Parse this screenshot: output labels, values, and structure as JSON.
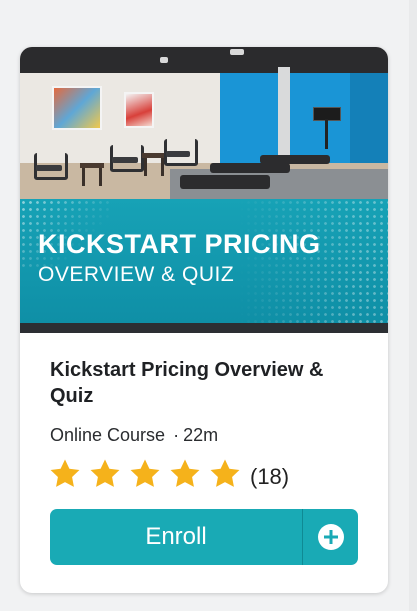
{
  "banner": {
    "title": "KICKSTART PRICING",
    "subtitle": "OVERVIEW & QUIZ"
  },
  "course": {
    "title": "Kickstart Pricing Overview & Quiz",
    "type": "Online Course",
    "separator": "·",
    "duration": "22m"
  },
  "rating": {
    "stars": 5,
    "count_label": "(18)",
    "star_icon": "star-icon",
    "star_color": "#f5b21b"
  },
  "enroll": {
    "label": "Enroll",
    "icon": "plus-circle-icon"
  },
  "colors": {
    "accent": "#19aab5",
    "banner_teal": "#1399ad",
    "banner_strip": "#2c2f33"
  }
}
